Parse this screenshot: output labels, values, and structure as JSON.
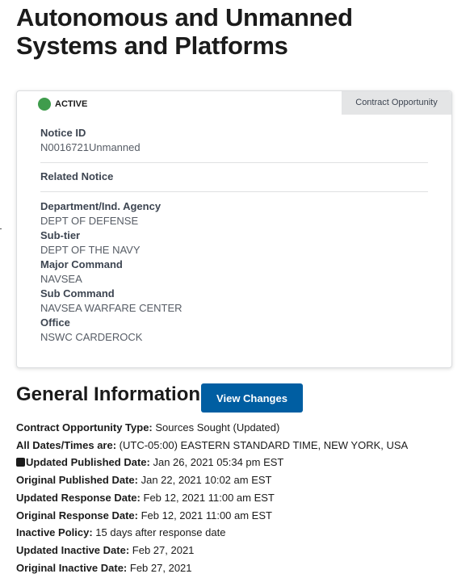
{
  "page": {
    "title": "Autonomous and Unmanned Systems and Platforms"
  },
  "card": {
    "status": "ACTIVE",
    "type_tag": "Contract Opportunity",
    "notice_id_label": "Notice ID",
    "notice_id_value": "N0016721Unmanned",
    "related_notice_label": "Related Notice",
    "department_label": "Department/Ind. Agency",
    "department_value": "DEPT OF DEFENSE",
    "subtier_label": "Sub-tier",
    "subtier_value": "DEPT OF THE NAVY",
    "major_command_label": "Major Command",
    "major_command_value": "NAVSEA",
    "sub_command_label": "Sub Command",
    "sub_command_value": "NAVSEA WARFARE CENTER",
    "office_label": "Office",
    "office_value": "NSWC CARDEROCK"
  },
  "general": {
    "title": "General Information",
    "view_changes_label": "View Changes",
    "rows": [
      {
        "key": "Contract Opportunity Type:",
        "value": "Sources Sought (Updated)"
      },
      {
        "key": "All Dates/Times are:",
        "value": "(UTC-05:00) EASTERN STANDARD TIME, NEW YORK, USA"
      },
      {
        "key": "Updated Published Date:",
        "value": "Jan 26, 2021 05:34 pm EST"
      },
      {
        "key": "Original Published Date:",
        "value": "Jan 22, 2021 10:02 am EST"
      },
      {
        "key": "Updated Response Date:",
        "value": "Feb 12, 2021 11:00 am EST"
      },
      {
        "key": "Original Response Date:",
        "value": "Feb 12, 2021 11:00 am EST"
      },
      {
        "key": "Inactive Policy:",
        "value": "15 days after response date"
      },
      {
        "key": "Updated Inactive Date:",
        "value": "Feb 27, 2021"
      },
      {
        "key": "Original Inactive Date:",
        "value": "Feb 27, 2021"
      }
    ]
  }
}
